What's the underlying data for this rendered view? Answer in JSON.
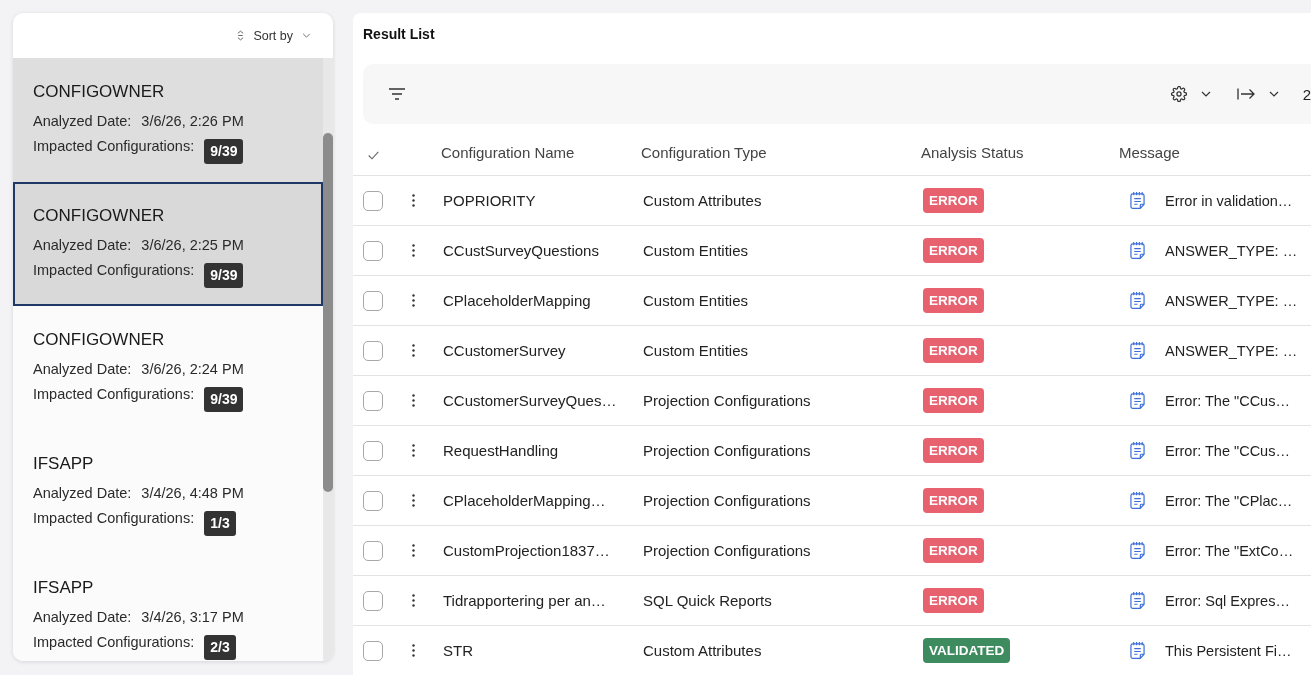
{
  "sidebar": {
    "sort": {
      "label": "Sort by"
    },
    "items": [
      {
        "owner": "CONFIGOWNER",
        "date_label": "Analyzed Date:",
        "date": "3/6/26, 2:26 PM",
        "impacted_label": "Impacted Configurations:",
        "impacted": "9/39",
        "selected": false,
        "hovered": true
      },
      {
        "owner": "CONFIGOWNER",
        "date_label": "Analyzed Date:",
        "date": "3/6/26, 2:25 PM",
        "impacted_label": "Impacted Configurations:",
        "impacted": "9/39",
        "selected": true,
        "hovered": false
      },
      {
        "owner": "CONFIGOWNER",
        "date_label": "Analyzed Date:",
        "date": "3/6/26, 2:24 PM",
        "impacted_label": "Impacted Configurations:",
        "impacted": "9/39",
        "selected": false,
        "hovered": false
      },
      {
        "owner": "IFSAPP",
        "date_label": "Analyzed Date:",
        "date": "3/4/26, 4:48 PM",
        "impacted_label": "Impacted Configurations:",
        "impacted": "1/3",
        "selected": false,
        "hovered": false
      },
      {
        "owner": "IFSAPP",
        "date_label": "Analyzed Date:",
        "date": "3/4/26, 3:17 PM",
        "impacted_label": "Impacted Configurations:",
        "impacted": "2/3",
        "selected": false,
        "hovered": false
      }
    ]
  },
  "result_list": {
    "title": "Result List",
    "toolbar": {
      "trailing_text": "2"
    },
    "table": {
      "columns": [
        "Configuration Name",
        "Configuration Type",
        "Analysis Status",
        "Message"
      ],
      "rows": [
        {
          "checked": false,
          "name": "POPRIORITY",
          "type": "Custom Attributes",
          "status": {
            "label": "ERROR",
            "kind": "error"
          },
          "message": "Error in validation…"
        },
        {
          "checked": false,
          "name": "CCustSurveyQuestions",
          "type": "Custom Entities",
          "status": {
            "label": "ERROR",
            "kind": "error"
          },
          "message": "ANSWER_TYPE: …"
        },
        {
          "checked": false,
          "name": "CPlaceholderMapping",
          "type": "Custom Entities",
          "status": {
            "label": "ERROR",
            "kind": "error"
          },
          "message": "ANSWER_TYPE: …"
        },
        {
          "checked": false,
          "name": "CCustomerSurvey",
          "type": "Custom Entities",
          "status": {
            "label": "ERROR",
            "kind": "error"
          },
          "message": "ANSWER_TYPE: …"
        },
        {
          "checked": false,
          "name": "CCustomerSurveyQues…",
          "type": "Projection Configurations",
          "status": {
            "label": "ERROR",
            "kind": "error"
          },
          "message": "Error: The \"CCus…"
        },
        {
          "checked": false,
          "name": "RequestHandling",
          "type": "Projection Configurations",
          "status": {
            "label": "ERROR",
            "kind": "error"
          },
          "message": "Error: The \"CCus…"
        },
        {
          "checked": false,
          "name": "CPlaceholderMapping…",
          "type": "Projection Configurations",
          "status": {
            "label": "ERROR",
            "kind": "error"
          },
          "message": "Error: The \"CPlac…"
        },
        {
          "checked": false,
          "name": "CustomProjection1837…",
          "type": "Projection Configurations",
          "status": {
            "label": "ERROR",
            "kind": "error"
          },
          "message": "Error: The \"ExtCo…"
        },
        {
          "checked": false,
          "name": "Tidrapportering per an…",
          "type": "SQL Quick Reports",
          "status": {
            "label": "ERROR",
            "kind": "error"
          },
          "message": "Error: Sql Expres…"
        },
        {
          "checked": false,
          "name": "STR",
          "type": "Custom Attributes",
          "status": {
            "label": "VALIDATED",
            "kind": "validated"
          },
          "message": "This Persistent Fi…"
        }
      ]
    }
  }
}
